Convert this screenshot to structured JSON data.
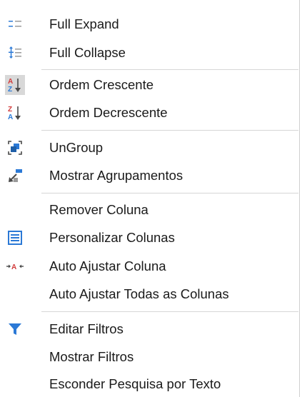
{
  "menu": {
    "items": [
      {
        "label": "Full Expand",
        "icon": "full-expand-icon"
      },
      {
        "label": "Full Collapse",
        "icon": "full-collapse-icon"
      },
      {
        "label": "Ordem Crescente",
        "icon": "sort-ascending-icon",
        "checked": true
      },
      {
        "label": "Ordem Decrescente",
        "icon": "sort-descending-icon"
      },
      {
        "label": "UnGroup",
        "icon": "ungroup-icon"
      },
      {
        "label": "Mostrar Agrupamentos",
        "icon": "group-panel-icon"
      },
      {
        "label": "Remover Coluna",
        "icon": ""
      },
      {
        "label": "Personalizar Colunas",
        "icon": "column-chooser-icon"
      },
      {
        "label": "Auto Ajustar Coluna",
        "icon": "auto-fit-icon"
      },
      {
        "label": "Auto Ajustar Todas as Colunas",
        "icon": ""
      },
      {
        "label": "Editar Filtros",
        "icon": "filter-icon"
      },
      {
        "label": "Mostrar Filtros",
        "icon": ""
      },
      {
        "label": "Esconder Pesquisa por Texto",
        "icon": ""
      }
    ]
  },
  "colors": {
    "accent_blue": "#2b79d6",
    "arrow_dark": "#4a4a4a",
    "checked_bg": "#d8d8d8",
    "separator": "#d6d6d6"
  }
}
